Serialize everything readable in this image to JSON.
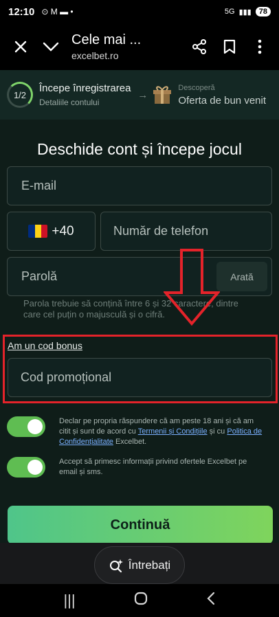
{
  "status_bar": {
    "time": "12:10",
    "left_icons": "⊙ M ▬ •",
    "network": "5G",
    "battery": "78"
  },
  "browser": {
    "title": "Cele mai ...",
    "domain": "excelbet.ro"
  },
  "progress": {
    "step_indicator": "1/2",
    "step1_title": "Începe înregistrarea",
    "step1_subtitle": "Detaliile contului",
    "step2_title": "Descoperă",
    "step2_subtitle": "Oferta de bun venit"
  },
  "form": {
    "heading": "Deschide cont și începe jocul",
    "email_placeholder": "E-mail",
    "country_code": "+40",
    "phone_placeholder": "Număr de telefon",
    "password_placeholder": "Parolă",
    "show_label": "Arată",
    "password_hint": "Parola trebuie să conțină între 6 și 32 caractere, dintre care cel puțin o majusculă și o cifră.",
    "bonus_link": "Am un cod bonus",
    "promo_placeholder": "Cod promoțional"
  },
  "consents": {
    "age_text_1": "Declar pe propria răspundere că am peste 18 ani și că am citit și sunt de acord cu ",
    "terms_link": "Termenii și Condițiile",
    "age_text_2": " și cu ",
    "privacy_link": "Politica de Confidențialitate",
    "age_text_3": " Excelbet.",
    "marketing_text": "Accept să primesc informații privind ofertele Excelbet pe email și sms.",
    "age_on": true,
    "marketing_on": true
  },
  "continue_label": "Continuă",
  "ask_label": "Întrebați",
  "colors": {
    "accent_green": "#5fbd52",
    "highlight_red": "#e4232a",
    "background": "#0f1d19"
  }
}
